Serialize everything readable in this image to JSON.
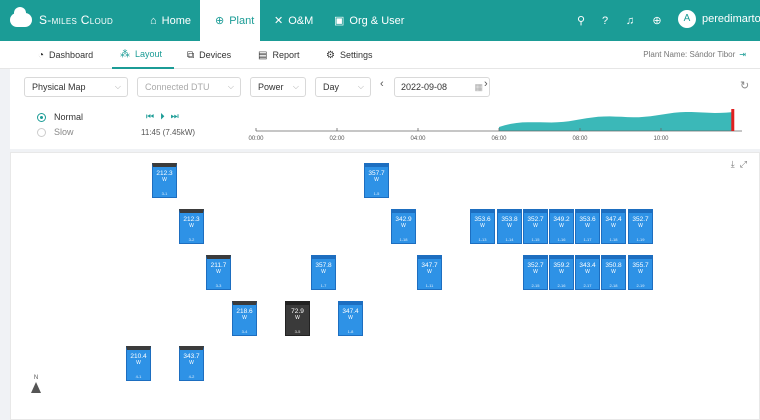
{
  "header": {
    "app_name": "S-miles Cloud",
    "nav": [
      {
        "label": "Home",
        "icon": "home-icon"
      },
      {
        "label": "Plant",
        "icon": "globe-icon"
      },
      {
        "label": "O&M",
        "icon": "tools-icon"
      },
      {
        "label": "Org & User",
        "icon": "org-icon"
      }
    ],
    "username": "peredimarton@",
    "avatar_letter": "A"
  },
  "subnav": {
    "tabs": [
      {
        "label": "Dashboard",
        "icon": "dashboard-icon"
      },
      {
        "label": "Layout",
        "icon": "layout-icon"
      },
      {
        "label": "Devices",
        "icon": "devices-icon"
      },
      {
        "label": "Report",
        "icon": "report-icon"
      },
      {
        "label": "Settings",
        "icon": "settings-icon"
      }
    ],
    "plant_name": "Plant Name: Sándor Tibor"
  },
  "controls": {
    "map_type": "Physical Map",
    "dtu": "Connected DTU",
    "metric": "Power",
    "period": "Day",
    "date": "2022-09-08"
  },
  "playback": {
    "speed_normal": "Normal",
    "speed_slow": "Slow",
    "current": "11:45 (7.45kW)",
    "ticks": [
      "00:00",
      "02:00",
      "04:00",
      "06:00",
      "08:00",
      "10:00"
    ],
    "progress_fraction": 0.98,
    "curve_color": "#3bb8b8"
  },
  "layout": {
    "north_label": "N",
    "unit": "W",
    "modules": [
      {
        "power": "212.3",
        "id": "3-1"
      },
      {
        "power": "357.7",
        "id": "1-5"
      },
      {
        "power": "212.3",
        "id": "3-2"
      },
      {
        "power": "342.9",
        "id": "1-18"
      },
      {
        "power": "353.6",
        "id": "1-13"
      },
      {
        "power": "353.8",
        "id": "1-14"
      },
      {
        "power": "352.7",
        "id": "1-15"
      },
      {
        "power": "349.2",
        "id": "1-16"
      },
      {
        "power": "353.6",
        "id": "1-17"
      },
      {
        "power": "347.4",
        "id": "1-18"
      },
      {
        "power": "352.7",
        "id": "1-19"
      },
      {
        "power": "211.7",
        "id": "3-3"
      },
      {
        "power": "357.8",
        "id": "1-7"
      },
      {
        "power": "347.7",
        "id": "1-11"
      },
      {
        "power": "352.7",
        "id": "2-15"
      },
      {
        "power": "359.2",
        "id": "2-16"
      },
      {
        "power": "343.4",
        "id": "2-17"
      },
      {
        "power": "350.8",
        "id": "2-18"
      },
      {
        "power": "355.7",
        "id": "2-19"
      },
      {
        "power": "218.6",
        "id": "3-4"
      },
      {
        "power": "72.9",
        "id": "3-5"
      },
      {
        "power": "347.4",
        "id": "1-8"
      },
      {
        "power": "210.4",
        "id": "4-1"
      },
      {
        "power": "343.7",
        "id": "4-2"
      }
    ]
  },
  "colors": {
    "brand": "#1b9c96",
    "module": "#2e92e6",
    "marker": "#e02020"
  }
}
